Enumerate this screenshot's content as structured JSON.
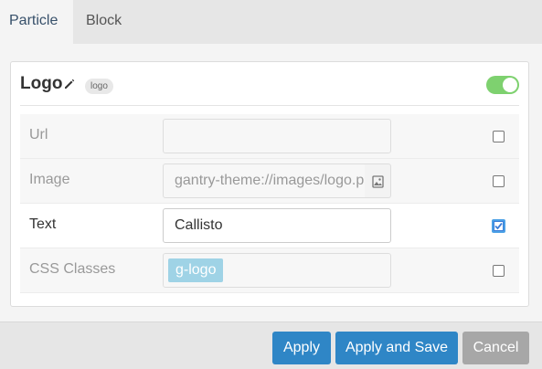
{
  "tabs": [
    {
      "label": "Particle",
      "active": true
    },
    {
      "label": "Block",
      "active": false
    }
  ],
  "card": {
    "title": "Logo",
    "badge": "logo",
    "enabled": true
  },
  "fields": {
    "url": {
      "label": "Url",
      "value": ""
    },
    "image": {
      "label": "Image",
      "value": "gantry-theme://images/logo.png"
    },
    "text": {
      "label": "Text",
      "value": "Callisto"
    },
    "css_classes": {
      "label": "CSS Classes",
      "tag": "g-logo"
    }
  },
  "buttons": {
    "apply": "Apply",
    "apply_save": "Apply and Save",
    "cancel": "Cancel"
  },
  "colors": {
    "primary": "#2f86c6",
    "toggle_on": "#7ed16f",
    "tag": "#9fd3e6"
  }
}
